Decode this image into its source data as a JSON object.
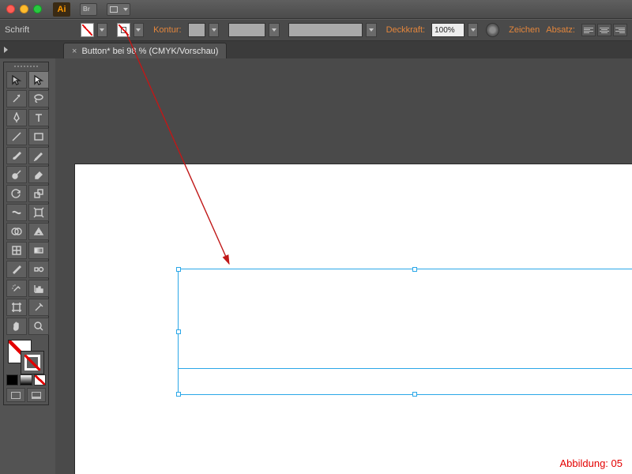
{
  "titlebar": {
    "app_abbr": "Ai",
    "br_label": "Br"
  },
  "optionsBar": {
    "schrift_label": "Schrift",
    "kontur_label": "Kontur:",
    "deckkraft_label": "Deckkraft:",
    "deckkraft_value": "100%",
    "link_zeichen": "Zeichen",
    "link_absatz": "Absatz:"
  },
  "document": {
    "tab_title": "Button* bei 98 % (CMYK/Vorschau)"
  },
  "tools": {
    "names": [
      "selection-tool",
      "direct-selection-tool",
      "magic-wand-tool",
      "lasso-tool",
      "pen-tool",
      "type-tool",
      "line-tool",
      "rectangle-tool",
      "paintbrush-tool",
      "pencil-tool",
      "blob-brush-tool",
      "eraser-tool",
      "rotate-tool",
      "scale-tool",
      "width-tool",
      "free-transform-tool",
      "shape-builder-tool",
      "perspective-grid-tool",
      "mesh-tool",
      "gradient-tool",
      "eyedropper-tool",
      "blend-tool",
      "symbol-sprayer-tool",
      "graph-tool",
      "artboard-tool",
      "slice-tool",
      "hand-tool",
      "zoom-tool"
    ]
  },
  "caption": "Abbildung: 05",
  "colors": {
    "selection": "#2aa7e8",
    "accent": "#e4863c",
    "annotation": "#c01818"
  }
}
